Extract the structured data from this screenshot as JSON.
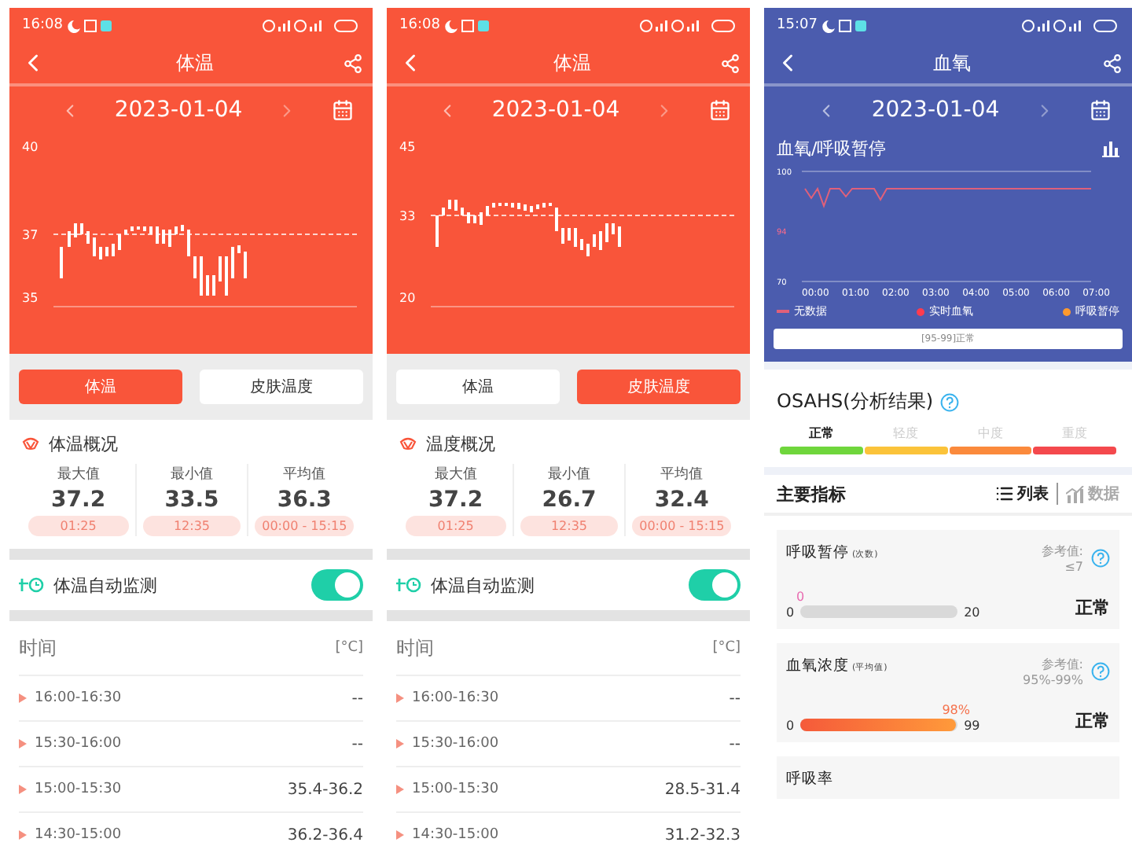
{
  "temperature_screens": [
    {
      "status_time": "16:08",
      "title": "体温",
      "date": "2023-01-04",
      "y_labels": [
        "40",
        "37",
        "35"
      ],
      "tabs": [
        {
          "label": "体温",
          "selected": true
        },
        {
          "label": "皮肤温度",
          "selected": false
        }
      ],
      "summary_title": "体温概况",
      "stats": [
        {
          "label": "最大值",
          "value": "37.2",
          "time": "01:25"
        },
        {
          "label": "最小值",
          "value": "33.5",
          "time": "12:35"
        },
        {
          "label": "平均值",
          "value": "36.3",
          "time": "00:00 - 15:15"
        }
      ],
      "monitor": {
        "label": "体温自动监测",
        "on": true
      },
      "table": {
        "columns": [
          "时间",
          "[°C]"
        ],
        "rows": [
          {
            "time": "16:00-16:30",
            "value": "--"
          },
          {
            "time": "15:30-16:00",
            "value": "--"
          },
          {
            "time": "15:00-15:30",
            "value": "35.4-36.2"
          },
          {
            "time": "14:30-15:00",
            "value": "36.2-36.4"
          }
        ]
      }
    },
    {
      "status_time": "16:08",
      "title": "体温",
      "date": "2023-01-04",
      "y_labels": [
        "45",
        "33",
        "20"
      ],
      "tabs": [
        {
          "label": "体温",
          "selected": false
        },
        {
          "label": "皮肤温度",
          "selected": true
        }
      ],
      "summary_title": "温度概况",
      "stats": [
        {
          "label": "最大值",
          "value": "37.2",
          "time": "01:25"
        },
        {
          "label": "最小值",
          "value": "26.7",
          "time": "12:35"
        },
        {
          "label": "平均值",
          "value": "32.4",
          "time": "00:00 - 15:15"
        }
      ],
      "monitor": {
        "label": "体温自动监测",
        "on": true
      },
      "table": {
        "columns": [
          "时间",
          "[°C]"
        ],
        "rows": [
          {
            "time": "16:00-16:30",
            "value": "--"
          },
          {
            "time": "15:30-16:00",
            "value": "--"
          },
          {
            "time": "15:00-15:30",
            "value": "28.5-31.4"
          },
          {
            "time": "14:30-15:00",
            "value": "31.2-32.3"
          }
        ]
      }
    }
  ],
  "oxygen_screen": {
    "status_time": "15:07",
    "title": "血氧",
    "date": "2023-01-04",
    "chart_title": "血氧/呼吸暂停",
    "y_labels": [
      "100",
      "94",
      "70"
    ],
    "x_labels": [
      "00:00",
      "01:00",
      "02:00",
      "03:00",
      "04:00",
      "05:00",
      "06:00",
      "07:00"
    ],
    "legend": [
      {
        "label": "无数据",
        "kind": "line",
        "color": "#e0607a"
      },
      {
        "label": "实时血氧",
        "kind": "dot",
        "color": "#ff3b4e"
      },
      {
        "label": "呼吸暂停",
        "kind": "dot",
        "color": "#ff9a2e"
      }
    ],
    "note": "[95-99]正常",
    "osahs_title": "OSAHS(分析结果)",
    "severity": [
      {
        "label": "正常",
        "selected": true,
        "color": "#6fd63c"
      },
      {
        "label": "轻度",
        "selected": false,
        "color": "#fbc33a"
      },
      {
        "label": "中度",
        "selected": false,
        "color": "#fb8a3c"
      },
      {
        "label": "重度",
        "selected": false,
        "color": "#f4494d"
      }
    ],
    "indicators_title": "主要指标",
    "views": [
      {
        "label": "列表",
        "kind": "list",
        "selected": true
      },
      {
        "label": "数据",
        "kind": "chart",
        "selected": false
      }
    ],
    "cards": [
      {
        "title": "呼吸暂停",
        "note": "(次数)",
        "ref_label": "参考值:",
        "ref_value": "≤7",
        "marker": "0",
        "min": "0",
        "max": "20",
        "level": 0,
        "status": "正常"
      },
      {
        "title": "血氧浓度",
        "note": "(平均值)",
        "ref_label": "参考值:",
        "ref_value": "95%-99%",
        "marker": "98%",
        "min": "0",
        "max": "99",
        "level": 0.99,
        "status": "正常"
      },
      {
        "title": "呼吸率"
      }
    ]
  }
}
